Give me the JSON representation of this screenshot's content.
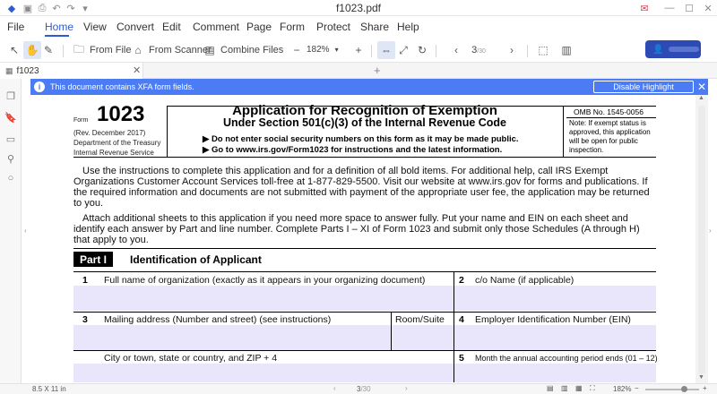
{
  "window": {
    "title": "f1023.pdf"
  },
  "menu": [
    "File",
    "Home",
    "View",
    "Convert",
    "Edit",
    "Comment",
    "Page",
    "Form",
    "Protect",
    "Share",
    "Help"
  ],
  "toolbar": {
    "from_file": "From File",
    "from_scanner": "From Scanner",
    "combine_files": "Combine Files",
    "zoom": "182%",
    "page_current": "3",
    "page_total": "/30"
  },
  "tab": {
    "name": "f1023"
  },
  "banner": {
    "message": "This document contains XFA form fields.",
    "button": "Disable Highlight"
  },
  "form": {
    "word": "Form",
    "number": "1023",
    "rev": [
      "(Rev. December 2017)",
      "Department of the Treasury",
      "Internal Revenue Service"
    ],
    "title": "Application for Recognition of Exemption",
    "subtitle": "Under Section 501(c)(3) of the Internal Revenue Code",
    "instr1": "▶ Do not enter social security numbers on this form as it may be made public.",
    "instr2": "▶ Go to www.irs.gov/Form1023 for instructions and the latest information.",
    "omb": "OMB No. 1545-0056",
    "note": "Note: If exempt status is approved, this application will be open for public inspection.",
    "para1": "Use the instructions to complete this application and for a definition of all bold items. For additional help, call IRS Exempt Organizations Customer Account Services toll-free at 1-877-829-5500. Visit our website at www.irs.gov for forms and  publications. If the required information and documents are not submitted with payment of the appropriate user fee, the application may be returned to you.",
    "para2": "Attach additional sheets to this application if you need more space to answer fully. Put your name and EIN on each sheet and identify each answer by Part and line number. Complete Parts I – XI of Form 1023 and submit only those Schedules (A through  H) that apply to you.",
    "part_label": "Part I",
    "part_title": "Identification of Applicant",
    "line1_num": "1",
    "line1_text": "Full name of organization (exactly as it appears in your organizing document)",
    "line2_num": "2",
    "line2_text": "c/o Name (if applicable)",
    "line3_num": "3",
    "line3_text": "Mailing address (Number and street) (see instructions)",
    "room_suite": "Room/Suite",
    "line4_num": "4",
    "line4_text": "Employer Identification Number (EIN)",
    "city_text": "City or town, state or country, and ZIP + 4",
    "line5_num": "5",
    "line5_text": "Month the annual accounting period ends (01 – 12)"
  },
  "status": {
    "page_size": "8.5 X 11 in",
    "page_current": "3",
    "page_total": "/30",
    "zoom": "182%"
  }
}
